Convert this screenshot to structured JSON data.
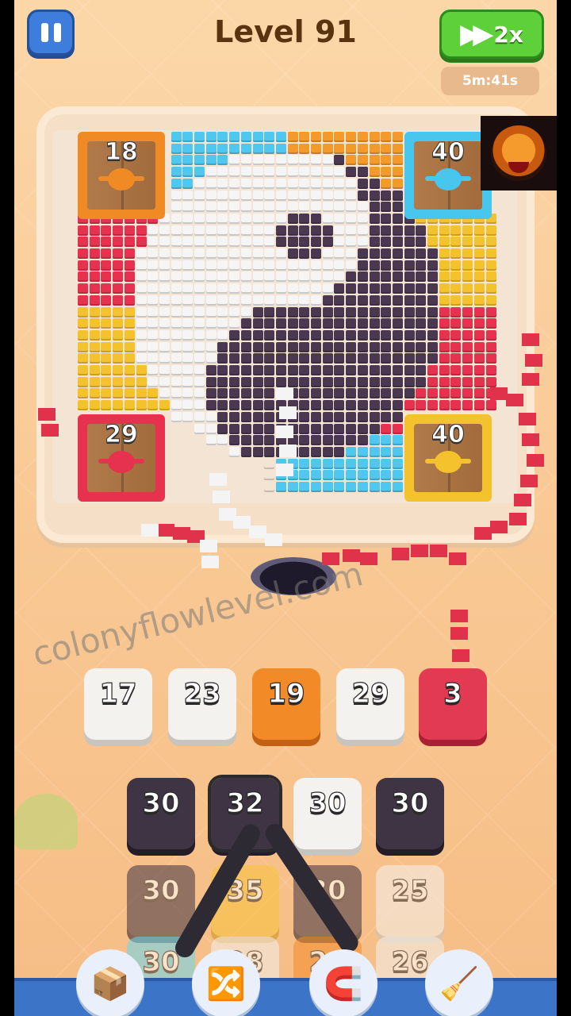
{
  "header": {
    "level_title": "Level 91",
    "speed_label": "2x",
    "timer": "5m:41s"
  },
  "icons": {
    "pause": "pause-icon",
    "fast_forward": "fast-forward-icon",
    "tiger": "tiger-logo"
  },
  "board": {
    "boxes": [
      {
        "count": "18",
        "color": "#f08a24"
      },
      {
        "count": "40",
        "color": "#49c6ee"
      },
      {
        "count": "29",
        "color": "#e6324e"
      },
      {
        "count": "40",
        "color": "#f4c22c"
      }
    ]
  },
  "queue_tiles": [
    {
      "value": "17",
      "color": "white"
    },
    {
      "value": "23",
      "color": "white"
    },
    {
      "value": "19",
      "color": "orange"
    },
    {
      "value": "29",
      "color": "white"
    },
    {
      "value": "3",
      "color": "red"
    }
  ],
  "stack_rows": [
    [
      {
        "value": "30",
        "color": "dark"
      },
      {
        "value": "32",
        "color": "dark"
      },
      {
        "value": "30",
        "color": "white"
      },
      {
        "value": "30",
        "color": "dark"
      }
    ],
    [
      {
        "value": "30",
        "color": "dark"
      },
      {
        "value": "35",
        "color": "yellow"
      },
      {
        "value": "30",
        "color": "dark"
      },
      {
        "value": "25",
        "color": "white"
      }
    ],
    [
      {
        "value": "30",
        "color": "blue"
      },
      {
        "value": "28",
        "color": "white"
      },
      {
        "value": "29",
        "color": "orange"
      },
      {
        "value": "26",
        "color": "white"
      }
    ]
  ],
  "watermark": "colonyflowlevel.com",
  "tools": [
    "add-box-tool-icon",
    "shuffle-tool-icon",
    "claw-tool-icon",
    "vacuum-tool-icon"
  ]
}
